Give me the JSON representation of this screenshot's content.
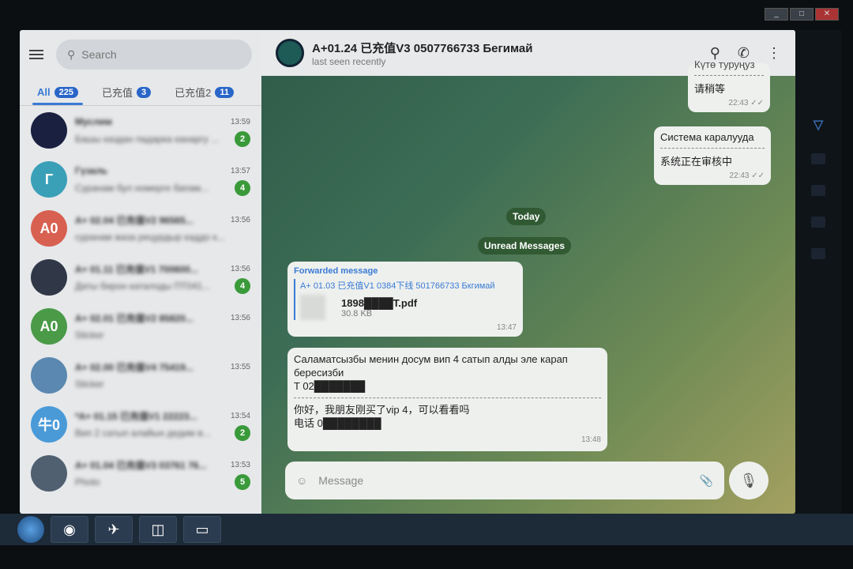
{
  "sidebar": {
    "search_placeholder": "Search",
    "tabs": [
      {
        "label": "All",
        "count": "225"
      },
      {
        "label": "已充值",
        "count": "3"
      },
      {
        "label": "已充值2",
        "count": "11"
      }
    ],
    "chats": [
      {
        "initials": "",
        "color": "#1a2040",
        "name": "Муслим",
        "preview": "Башы каздан падарка канаргу ...",
        "time": "13:59",
        "unread": "2"
      },
      {
        "initials": "Г",
        "color": "#3aa0b8",
        "name": "Гүзаль",
        "preview": "Суранам бул номерге бапам...",
        "time": "13:57",
        "unread": "4"
      },
      {
        "initials": "A0",
        "color": "#d86050",
        "name": "A+ 02.04 已充值V2 96565...",
        "preview": "суранам жаза рeцурдыр каддо к...",
        "time": "13:56",
        "unread": ""
      },
      {
        "initials": "",
        "color": "#303848",
        "name": "A+ 01.11 已充值V1 700600...",
        "preview": "Даты бирон каталоды ПТ041...",
        "time": "13:56",
        "unread": "4"
      },
      {
        "initials": "A0",
        "color": "#4a9a48",
        "name": "A+ 02.01 已充值V2 85820...",
        "preview": "Sticker",
        "time": "13:56",
        "unread": ""
      },
      {
        "initials": "",
        "color": "#5a88b0",
        "name": "A+ 02.00 已充值V4 75419...",
        "preview": "Sticker",
        "time": "13:55",
        "unread": ""
      },
      {
        "initials": "牛0",
        "color": "#4a9ad8",
        "name": "*A+ 01.15 已充值V1 22223...",
        "preview": "Вип 2 сатып алайын дедим в...",
        "time": "13:54",
        "unread": "2"
      },
      {
        "initials": "",
        "color": "#506070",
        "name": "A+ 01.04 已充值V3 03761 76...",
        "preview": "Photo",
        "time": "13:53",
        "unread": "5"
      }
    ]
  },
  "chat": {
    "title": "A+01.24 已充值V3 0507766733 Бегимай",
    "status": "last seen recently",
    "msg1": {
      "line1": "Күтө туруңуз",
      "line2": "请稍等",
      "time": "22:43"
    },
    "msg2": {
      "line1": "Система каралууда",
      "line2": "系统正在审核中",
      "time": "22:43"
    },
    "today": "Today",
    "unread": "Unread Messages",
    "fwd": {
      "label": "Forwarded message",
      "from": "A+ 01.03 已充值V1 0384下线 501766733 Бкгимай",
      "file": "1898████T.pdf",
      "size": "30.8 KB",
      "time": "13:47"
    },
    "msg3": {
      "line1": "Саламатсызбы менин досум вип 4 сатып алды эле карап бересизби",
      "line2": "T 02███████",
      "line3": "你好，我朋友刚买了vip 4，可以看看吗",
      "line4": "电话 0████████",
      "time": "13:48"
    },
    "compose_placeholder": "Message"
  }
}
